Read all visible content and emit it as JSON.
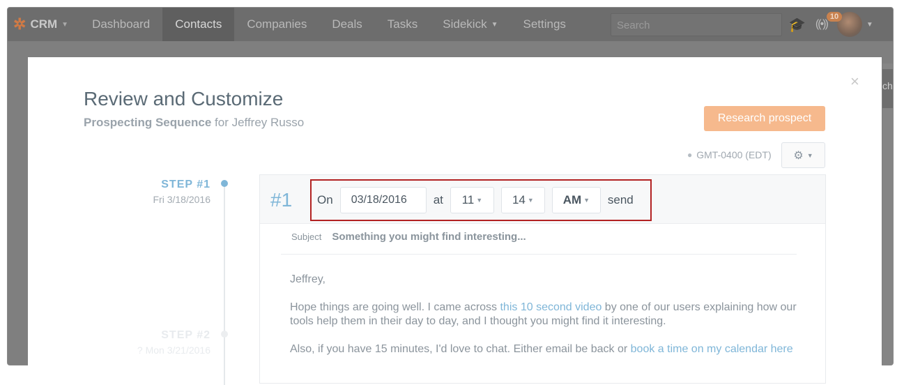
{
  "nav": {
    "brand": "CRM",
    "items": [
      {
        "label": "Dashboard",
        "active": false
      },
      {
        "label": "Contacts",
        "active": true
      },
      {
        "label": "Companies",
        "active": false
      },
      {
        "label": "Deals",
        "active": false
      },
      {
        "label": "Tasks",
        "active": false
      },
      {
        "label": "Sidekick",
        "active": false,
        "dropdown": true
      },
      {
        "label": "Settings",
        "active": false
      }
    ],
    "search_placeholder": "Search",
    "notification_count": "10",
    "right_peek_tab": "ch"
  },
  "modal": {
    "title": "Review and Customize",
    "subtitle_bold": "Prospecting Sequence",
    "subtitle_rest": "for Jeffrey Russo",
    "research_button": "Research prospect",
    "timezone": "GMT-0400 (EDT)",
    "close": "×"
  },
  "steps": [
    {
      "label": "STEP #1",
      "date": "Fri 3/18/2016"
    },
    {
      "label": "STEP #2",
      "date": "Mon 3/21/2016"
    }
  ],
  "card": {
    "number": "#1",
    "on_label": "On",
    "date": "03/18/2016",
    "at_label": "at",
    "hour": "11",
    "minute": "14",
    "ampm": "AM",
    "send_label": "send",
    "subject_label": "Subject",
    "subject": "Something you might find interesting...",
    "greeting": "Jeffrey,",
    "p1_before": "Hope things are going well. I came across ",
    "p1_link": "this 10 second video",
    "p1_after": " by one of our users explaining how our tools help them in their day to day, and I thought you might find it interesting.",
    "p2_before": "Also, if you have 15 minutes, I'd love to chat. Either email be back or ",
    "p2_link": "book a time on my calendar here"
  },
  "colors": {
    "accent_blue": "#7fb6d8",
    "cta_orange": "#f6b98d",
    "highlight_red": "#b22222"
  }
}
